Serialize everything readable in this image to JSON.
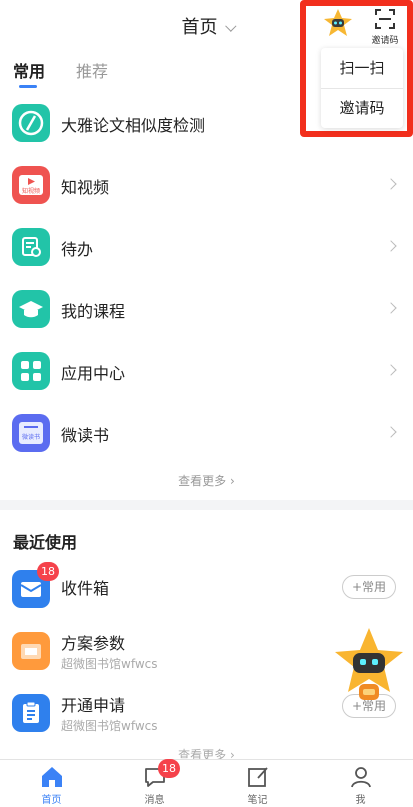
{
  "header": {
    "title": "首页"
  },
  "tabs": [
    {
      "label": "常用"
    },
    {
      "label": "推荐"
    }
  ],
  "apps": [
    {
      "label": "大雅论文相似度检测"
    },
    {
      "label": "知视频"
    },
    {
      "label": "待办"
    },
    {
      "label": "我的课程"
    },
    {
      "label": "应用中心"
    },
    {
      "label": "微读书"
    }
  ],
  "app_icons": {
    "zhishipin_text": "知视频",
    "weidushu_text": "微读书"
  },
  "apps_more": "查看更多",
  "recent": {
    "title": "最近使用",
    "add_label": "+常用",
    "items": [
      {
        "name": "收件箱",
        "subtitle": "",
        "badge": "18"
      },
      {
        "name": "方案参数",
        "subtitle": "超微图书馆wfwcs"
      },
      {
        "name": "开通申请",
        "subtitle": "超微图书馆wfwcs"
      }
    ],
    "more": "查看更多"
  },
  "popup": {
    "items": [
      {
        "label": "扫一扫"
      },
      {
        "label": "邀请码"
      }
    ]
  },
  "scan_label": "邀请码",
  "tabbar": {
    "items": [
      {
        "label": "首页",
        "icon": "home-icon",
        "active": true
      },
      {
        "label": "消息",
        "icon": "message-icon",
        "badge": "18"
      },
      {
        "label": "笔记",
        "icon": "note-icon"
      },
      {
        "label": "我",
        "icon": "profile-icon"
      }
    ]
  },
  "colors": {
    "accent": "#3b82f6",
    "badge": "#f5424b",
    "highlight_outline": "#f22f1d",
    "teal": "#22c4a8"
  }
}
